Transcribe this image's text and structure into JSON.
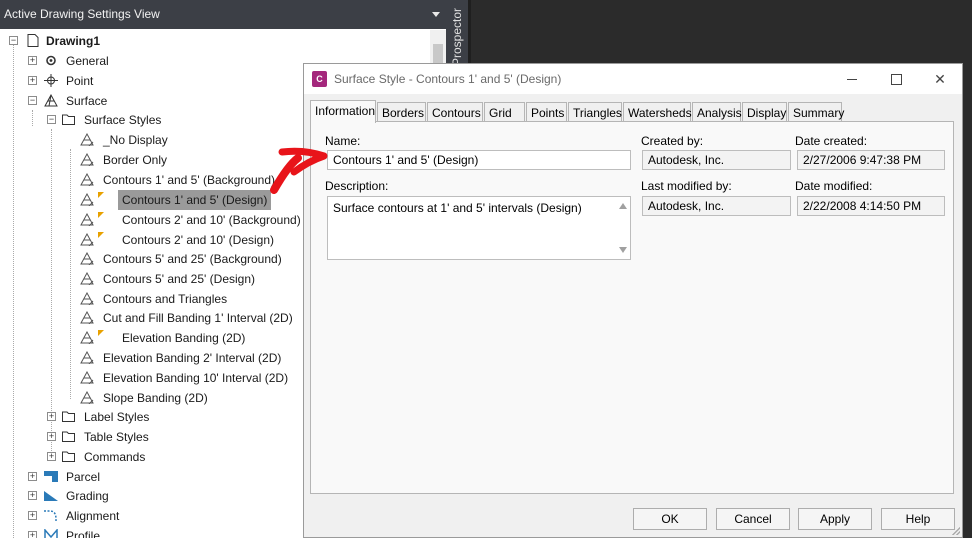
{
  "panel": {
    "view_selector": "Active Drawing Settings View",
    "prospector_tab": "Prospector"
  },
  "tree": {
    "root": "Drawing1",
    "items": [
      {
        "label": "General"
      },
      {
        "label": "Point"
      },
      {
        "label": "Surface"
      },
      {
        "label": "Surface Styles"
      },
      {
        "label": "_No Display"
      },
      {
        "label": "Border Only"
      },
      {
        "label": "Contours 1' and 5' (Background)"
      },
      {
        "label": "Contours 1' and 5' (Design)"
      },
      {
        "label": "Contours 2' and 10' (Background)"
      },
      {
        "label": "Contours 2' and 10' (Design)"
      },
      {
        "label": "Contours 5' and 25' (Background)"
      },
      {
        "label": "Contours 5' and 25' (Design)"
      },
      {
        "label": "Contours and Triangles"
      },
      {
        "label": "Cut and Fill Banding 1' Interval (2D)"
      },
      {
        "label": "Elevation Banding (2D)"
      },
      {
        "label": "Elevation Banding 2' Interval (2D)"
      },
      {
        "label": "Elevation Banding 10' Interval (2D)"
      },
      {
        "label": "Slope Banding (2D)"
      },
      {
        "label": "Label Styles"
      },
      {
        "label": "Table Styles"
      },
      {
        "label": "Commands"
      },
      {
        "label": "Parcel"
      },
      {
        "label": "Grading"
      },
      {
        "label": "Alignment"
      },
      {
        "label": "Profile"
      }
    ]
  },
  "dialog": {
    "title": "Surface Style - Contours 1' and 5' (Design)",
    "app_icon": "C",
    "tabs": [
      {
        "label": "Information"
      },
      {
        "label": "Borders"
      },
      {
        "label": "Contours"
      },
      {
        "label": "Grid"
      },
      {
        "label": "Points"
      },
      {
        "label": "Triangles"
      },
      {
        "label": "Watersheds"
      },
      {
        "label": "Analysis"
      },
      {
        "label": "Display"
      },
      {
        "label": "Summary"
      }
    ],
    "active_tab": "Information",
    "fields": {
      "name_label": "Name:",
      "name_value": "Contours 1' and 5' (Design)",
      "description_label": "Description:",
      "description_value": "Surface contours at 1' and 5' intervals (Design)",
      "created_by_label": "Created by:",
      "created_by_value": "Autodesk, Inc.",
      "date_created_label": "Date created:",
      "date_created_value": "2/27/2006 9:47:38 PM",
      "last_modified_by_label": "Last modified by:",
      "last_modified_by_value": "Autodesk, Inc.",
      "date_modified_label": "Date modified:",
      "date_modified_value": "2/22/2008 4:14:50 PM"
    },
    "buttons": {
      "ok": "OK",
      "cancel": "Cancel",
      "apply": "Apply",
      "help": "Help"
    }
  },
  "colors": {
    "accent": "#a4277c",
    "annotation": "#e8141a",
    "selection": "#9a9a9a",
    "flag": "#e8a100"
  }
}
